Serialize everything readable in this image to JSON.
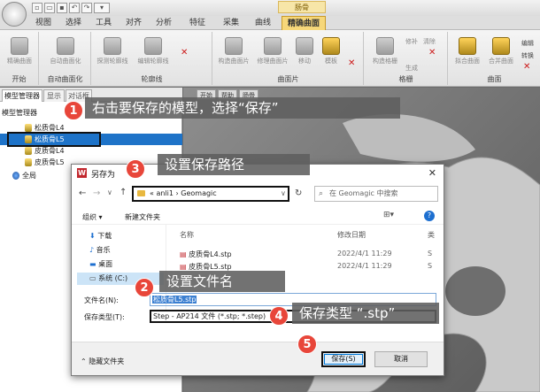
{
  "ribbon": {
    "context_label": "肠骨",
    "tabs": [
      "视图",
      "选择",
      "工具",
      "对齐",
      "分析",
      "特征",
      "采集",
      "曲线",
      "精确曲面"
    ],
    "groups": [
      {
        "label": "开始",
        "buttons": [
          "精确曲面"
        ]
      },
      {
        "label": "自动曲面化",
        "buttons": [
          "自动曲面化"
        ]
      },
      {
        "label": "轮廓线",
        "buttons": [
          "探测轮廓线",
          "编辑轮廓线"
        ]
      },
      {
        "label": "曲面片",
        "buttons": [
          "构造曲面片",
          "修理曲面片",
          "移动",
          "模板"
        ]
      },
      {
        "label": "格栅",
        "buttons": [
          "构造格栅",
          "修补",
          "清除",
          "生成"
        ]
      },
      {
        "label": "曲面",
        "buttons": [
          "拟合曲面",
          "合并曲面",
          "编辑",
          "转换"
        ]
      }
    ]
  },
  "panel": {
    "tabs": [
      "模型管理器",
      "显示",
      "对话框"
    ],
    "title": "模型管理器",
    "items": [
      {
        "label": "松质骨L4",
        "selected": false
      },
      {
        "label": "松质骨L5",
        "selected": true
      },
      {
        "label": "皮质骨L4",
        "selected": false
      },
      {
        "label": "皮质骨L5",
        "selected": false
      },
      {
        "label": "全局",
        "selected": false
      }
    ]
  },
  "viewport": {
    "tabs": [
      "开始",
      "帮助",
      "肠骨"
    ]
  },
  "dialog": {
    "title": "另存为",
    "logo": "W",
    "path": [
      "«",
      "anli1",
      "›",
      "Geomagic"
    ],
    "search_placeholder": "在 Geomagic 中搜索",
    "organize": "组织 ▾",
    "new_folder": "新建文件夹",
    "sidebar": [
      {
        "label": "下载",
        "selected": false
      },
      {
        "label": "音乐",
        "selected": false
      },
      {
        "label": "桌面",
        "selected": false
      },
      {
        "label": "系统 (C:)",
        "selected": true
      }
    ],
    "columns": [
      "名称",
      "修改日期",
      "类"
    ],
    "files": [
      {
        "name": "皮质骨L4.stp",
        "date": "2022/4/1 11:29",
        "type": "S"
      },
      {
        "name": "皮质骨L5.stp",
        "date": "2022/4/1 11:29",
        "type": "S"
      }
    ],
    "filename_label": "文件名(N):",
    "filename_value": "松质骨L5.stp",
    "filetype_label": "保存类型(T):",
    "filetype_value": "Step - AP214 文件 (*.stp; *.step)",
    "hide_folders": "隐藏文件夹",
    "save": "保存(S)",
    "cancel": "取消"
  },
  "callouts": [
    {
      "num": "1",
      "text": "右击要保存的模型，选择“保存”"
    },
    {
      "num": "2",
      "text": "设置文件名"
    },
    {
      "num": "3",
      "text": "设置保存路径"
    },
    {
      "num": "4",
      "text": "保存类型 “.stp”"
    },
    {
      "num": "5",
      "text": ""
    }
  ],
  "colors": {
    "accent": "#f6d77a",
    "selection": "#1e73c8",
    "badge": "#e8463a"
  }
}
